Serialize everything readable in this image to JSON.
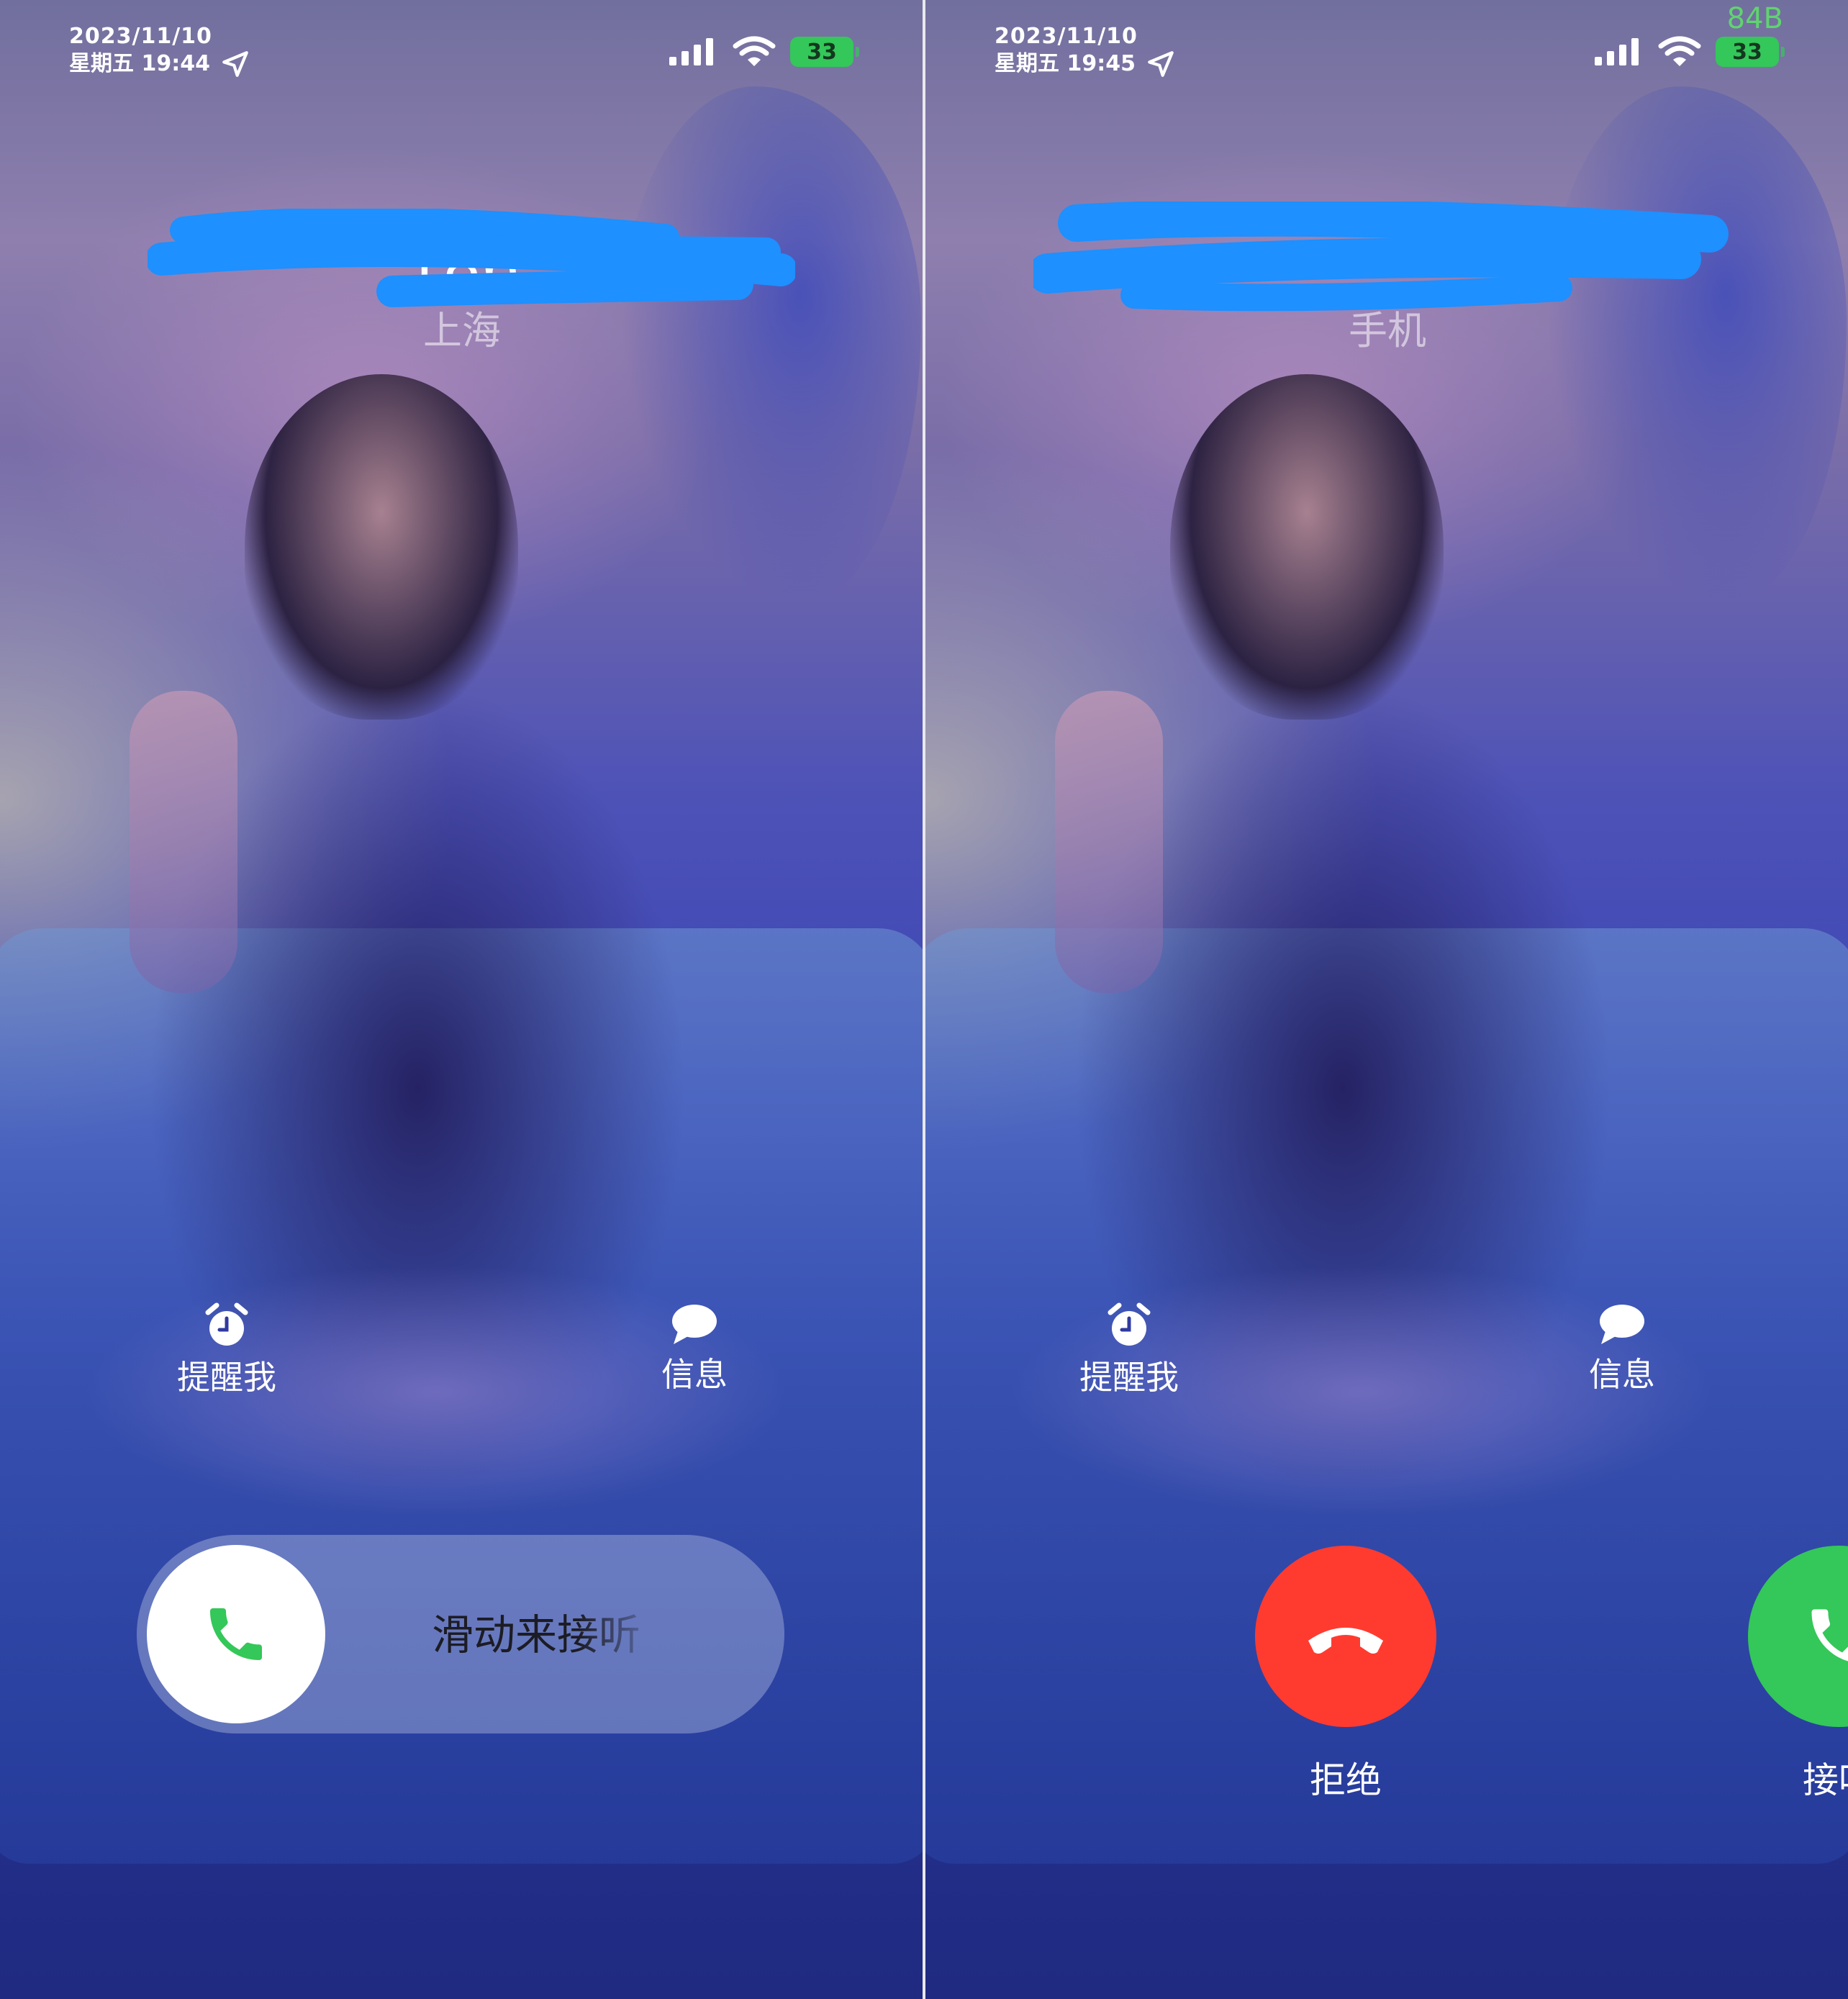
{
  "colors": {
    "accept_green": "#34c759",
    "decline_red": "#ff3b30",
    "battery_green": "#34c759",
    "redaction_blue": "#1e90ff",
    "net_speed_green": "#5fd46f"
  },
  "left_screen": {
    "status": {
      "date": "2023/11/10",
      "weekday_time": "星期五 19:44",
      "battery": "33",
      "icons": [
        "location-arrow-icon",
        "cellular-signal-icon",
        "wifi-icon",
        "battery-icon"
      ]
    },
    "caller": {
      "number_partial": "186 ",
      "location": "上海"
    },
    "actions": {
      "remind_label": "提醒我",
      "remind_icon": "alarm-clock-icon",
      "message_label": "信息",
      "message_icon": "message-bubble-icon"
    },
    "slider": {
      "label": "滑动来接听",
      "icon": "phone-handset-icon"
    }
  },
  "right_screen": {
    "status": {
      "date": "2023/11/10",
      "weekday_time": "星期五 19:45",
      "battery": "33",
      "net_speed": "84B",
      "icons": [
        "location-arrow-icon",
        "cellular-signal-icon",
        "wifi-icon",
        "battery-icon"
      ]
    },
    "caller": {
      "label": "手机"
    },
    "actions": {
      "remind_label": "提醒我",
      "remind_icon": "alarm-clock-icon",
      "message_label": "信息",
      "message_icon": "message-bubble-icon"
    },
    "buttons": {
      "decline_label": "拒绝",
      "decline_icon": "phone-hangup-icon",
      "accept_label": "接听",
      "accept_icon": "phone-handset-icon"
    }
  }
}
